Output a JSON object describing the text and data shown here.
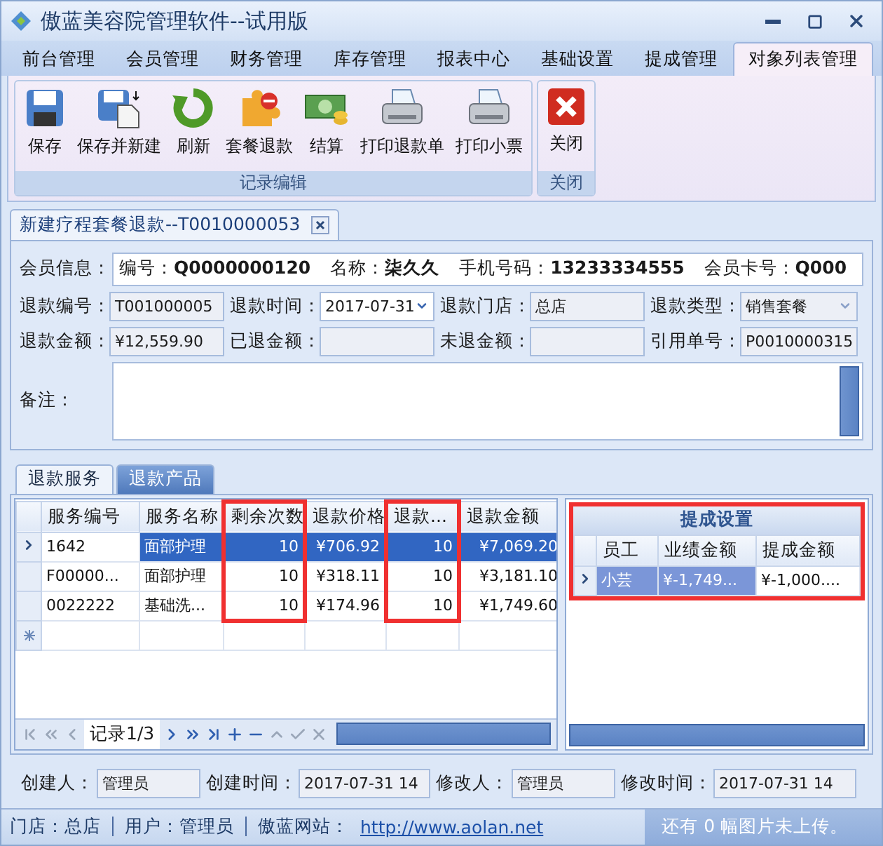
{
  "window": {
    "title": "傲蓝美容院管理软件--试用版"
  },
  "menu_tabs": [
    {
      "label": "前台管理",
      "selected": false
    },
    {
      "label": "会员管理",
      "selected": false
    },
    {
      "label": "财务管理",
      "selected": false
    },
    {
      "label": "库存管理",
      "selected": false
    },
    {
      "label": "报表中心",
      "selected": false
    },
    {
      "label": "基础设置",
      "selected": false
    },
    {
      "label": "提成管理",
      "selected": false
    },
    {
      "label": "对象列表管理",
      "selected": true
    }
  ],
  "ribbon": {
    "groups": [
      {
        "title": "记录编辑",
        "buttons": [
          {
            "label": "保存",
            "kind": "save"
          },
          {
            "label": "保存并新建",
            "kind": "save-new"
          },
          {
            "label": "刷新",
            "kind": "refresh"
          },
          {
            "label": "套餐退款",
            "kind": "puzzle"
          },
          {
            "label": "结算",
            "kind": "money"
          },
          {
            "label": "打印退款单",
            "kind": "print"
          },
          {
            "label": "打印小票",
            "kind": "print"
          }
        ]
      },
      {
        "title": "关闭",
        "buttons": [
          {
            "label": "关闭",
            "kind": "close"
          }
        ]
      }
    ]
  },
  "document_tab": {
    "title": "新建疗程套餐退款--T0010000053"
  },
  "member_info": {
    "label": "会员信息：",
    "fields": [
      {
        "label": "编号：",
        "value": "Q0000000120"
      },
      {
        "label": "名称：",
        "value": "柒久久"
      },
      {
        "label": "手机号码：",
        "value": "13233334555"
      },
      {
        "label": "会员卡号：",
        "value": "Q000"
      }
    ]
  },
  "form_rows": [
    [
      {
        "label": "退款编号：",
        "value": "T001000005",
        "kind": "text"
      },
      {
        "label": "退款时间：",
        "value": "2017-07-31",
        "kind": "date"
      },
      {
        "label": "退款门店：",
        "value": "总店",
        "kind": "text"
      },
      {
        "label": "退款类型：",
        "value": "销售套餐",
        "kind": "select"
      }
    ],
    [
      {
        "label": "退款金额：",
        "value": "¥12,559.90",
        "kind": "text"
      },
      {
        "label": "已退金额：",
        "kind": "text"
      },
      {
        "label": "未退金额：",
        "kind": "text"
      },
      {
        "label": "引用单号：",
        "value": "P0010000315",
        "kind": "text"
      }
    ]
  ],
  "remarks": {
    "label": "备注："
  },
  "sub_tabs": [
    {
      "label": "退款服务",
      "selected": true
    },
    {
      "label": "退款产品",
      "selected": false
    }
  ],
  "service_grid": {
    "columns": [
      {
        "label": "服务编号",
        "highlighted": false
      },
      {
        "label": "服务名称",
        "highlighted": false
      },
      {
        "label": "剩余次数",
        "highlighted": true
      },
      {
        "label": "退款价格",
        "highlighted": false
      },
      {
        "label": "退款...",
        "highlighted": true
      },
      {
        "label": "退款金额",
        "highlighted": false
      }
    ],
    "rows": [
      {
        "selected": true,
        "cells": [
          "1642",
          "面部护理",
          "10",
          "¥706.92",
          "10",
          "¥7,069.20"
        ]
      },
      {
        "selected": false,
        "cells": [
          "F00000...",
          "面部护理",
          "10",
          "¥318.11",
          "10",
          "¥3,181.10"
        ]
      },
      {
        "selected": false,
        "cells": [
          "0022222",
          "基础洗...",
          "10",
          "¥174.96",
          "10",
          "¥1,749.60"
        ]
      }
    ],
    "navigator": "记录1/3"
  },
  "commission": {
    "title": "提成设置",
    "highlighted": true,
    "columns": [
      "员工",
      "业绩金额",
      "提成金额"
    ],
    "rows": [
      {
        "selected": true,
        "cells": [
          "小芸",
          "¥-1,749...",
          "¥-1,000...."
        ]
      }
    ]
  },
  "footer_fields": [
    {
      "label": "创建人：",
      "value": "管理员"
    },
    {
      "label": "创建时间：",
      "value": "2017-07-31 14"
    },
    {
      "label": "修改人：",
      "value": "管理员"
    },
    {
      "label": "修改时间：",
      "value": "2017-07-31 14"
    }
  ],
  "status_bar": {
    "items": [
      {
        "kind": "text",
        "text": "门店：总店"
      },
      {
        "kind": "text",
        "text": "用户：管理员"
      },
      {
        "kind": "text",
        "text": "傲蓝网站："
      },
      {
        "kind": "link",
        "text": "http://www.aolan.net"
      }
    ],
    "upload_note": "还有 0 幅图片未上传。"
  }
}
